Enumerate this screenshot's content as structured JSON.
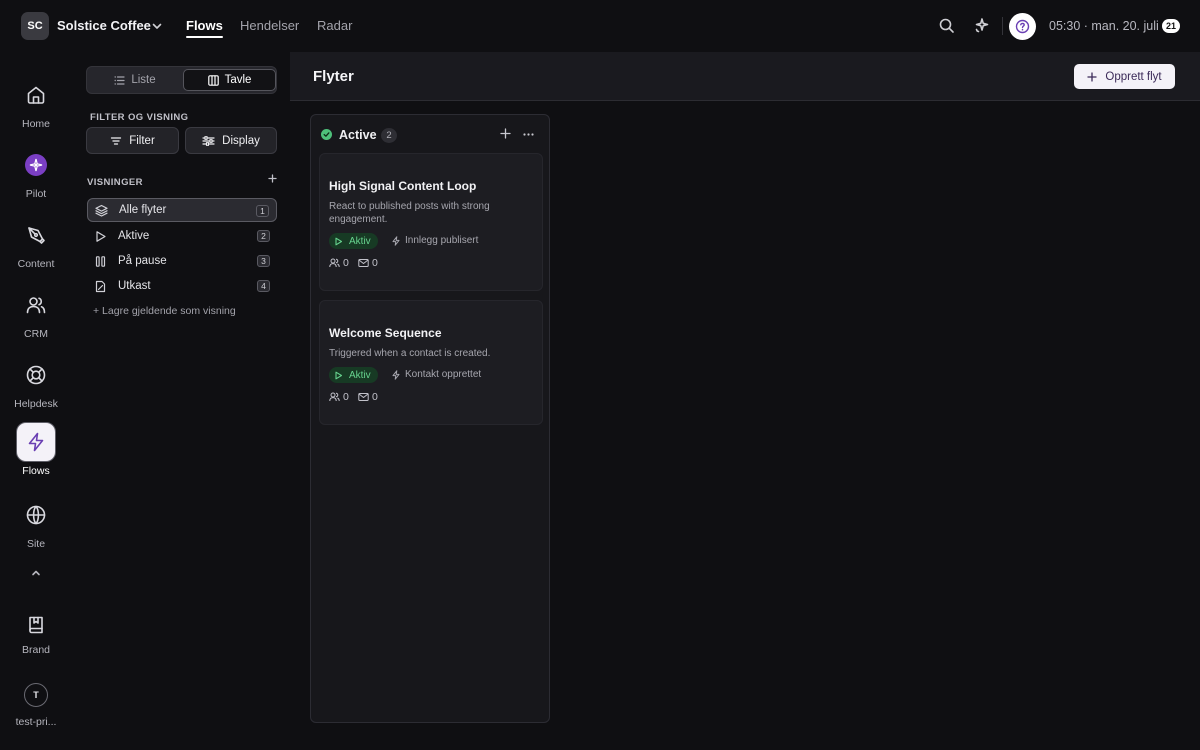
{
  "workspace": {
    "initials": "SC",
    "name": "Solstice Coffee"
  },
  "top_nav": {
    "tabs": [
      "Flows",
      "Hendelser",
      "Radar"
    ],
    "active": "Flows"
  },
  "top_right": {
    "clock": "05:30 · man. 20. juli",
    "notification_count": "21"
  },
  "rail": {
    "items": [
      {
        "label": "Home",
        "icon": "home-icon"
      },
      {
        "label": "Pilot",
        "icon": "pilot-icon"
      },
      {
        "label": "Content",
        "icon": "pen-nib-icon"
      },
      {
        "label": "CRM",
        "icon": "users-icon"
      },
      {
        "label": "Helpdesk",
        "icon": "lifebuoy-icon"
      },
      {
        "label": "Flows",
        "icon": "bolt-icon",
        "active": true
      },
      {
        "label": "Site",
        "icon": "globe-icon"
      }
    ],
    "brand_label": "Brand",
    "user_initial": "T",
    "user_label": "test-pri..."
  },
  "panel": {
    "view_toggle": {
      "list": "Liste",
      "board": "Tavle",
      "selected": "Tavle"
    },
    "filter_section_label": "FILTER OG VISNING",
    "filter_button": "Filter",
    "display_button": "Display",
    "views_section_label": "VISNINGER",
    "views": [
      {
        "label": "Alle flyter",
        "count": "1",
        "icon": "layers-icon",
        "selected": true
      },
      {
        "label": "Aktive",
        "count": "2",
        "icon": "play-icon"
      },
      {
        "label": "På pause",
        "count": "3",
        "icon": "pause-icon"
      },
      {
        "label": "Utkast",
        "count": "4",
        "icon": "draft-icon"
      }
    ],
    "save_view_label": "+ Lagre gjeldende som visning"
  },
  "main": {
    "title": "Flyter",
    "create_button": "Opprett flyt"
  },
  "board": {
    "columns": [
      {
        "title": "Active",
        "count": "2",
        "status_color": "#4ec07a",
        "cards": [
          {
            "title": "High Signal Content Loop",
            "description": "React to published posts with strong engagement.",
            "status": "Aktiv",
            "trigger": "Innlegg publisert",
            "contacts": "0",
            "emails": "0"
          },
          {
            "title": "Welcome Sequence",
            "description": "Triggered when a contact is created.",
            "status": "Aktiv",
            "trigger": "Kontakt opprettet",
            "contacts": "0",
            "emails": "0"
          }
        ]
      }
    ]
  },
  "colors": {
    "accent": "#6a3fb3",
    "status_active": "#4ec07a",
    "background": "#0f0f12"
  }
}
